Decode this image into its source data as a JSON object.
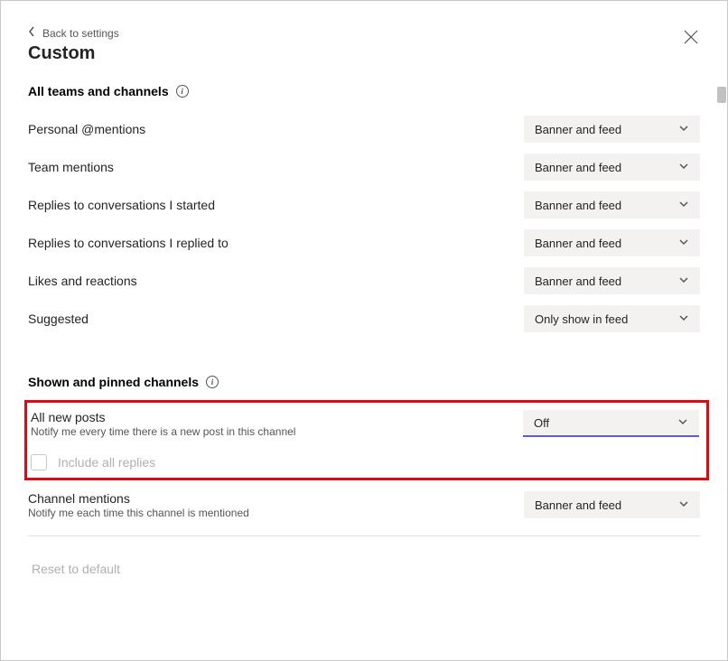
{
  "header": {
    "back_label": "Back to settings",
    "title": "Custom"
  },
  "section1": {
    "heading": "All teams and channels",
    "rows": [
      {
        "label": "Personal @mentions",
        "value": "Banner and feed"
      },
      {
        "label": "Team mentions",
        "value": "Banner and feed"
      },
      {
        "label": "Replies to conversations I started",
        "value": "Banner and feed"
      },
      {
        "label": "Replies to conversations I replied to",
        "value": "Banner and feed"
      },
      {
        "label": "Likes and reactions",
        "value": "Banner and feed"
      },
      {
        "label": "Suggested",
        "value": "Only show in feed"
      }
    ]
  },
  "section2": {
    "heading": "Shown and pinned channels",
    "all_new_posts": {
      "label": "All new posts",
      "sublabel": "Notify me every time there is a new post in this channel",
      "value": "Off"
    },
    "include_replies": "Include all replies",
    "channel_mentions": {
      "label": "Channel mentions",
      "sublabel": "Notify me each time this channel is mentioned",
      "value": "Banner and feed"
    }
  },
  "footer": {
    "reset": "Reset to default"
  }
}
